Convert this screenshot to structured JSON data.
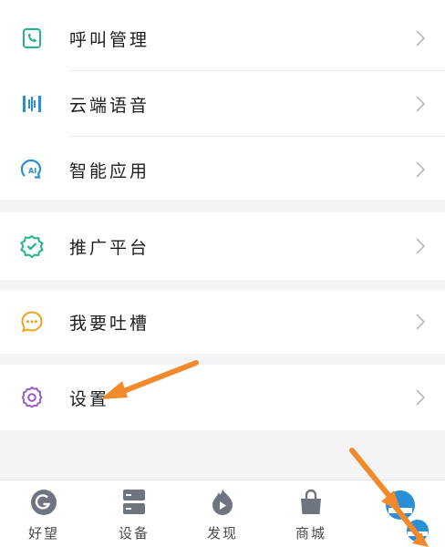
{
  "menu": {
    "items": [
      {
        "label": "呼叫管理",
        "icon": "phone-card-icon"
      },
      {
        "label": "云端语音",
        "icon": "voice-wave-icon"
      },
      {
        "label": "智能应用",
        "icon": "ai-head-icon"
      },
      {
        "label": "推广平台",
        "icon": "verified-badge-icon"
      },
      {
        "label": "我要吐槽",
        "icon": "chat-bubble-icon"
      },
      {
        "label": "设置",
        "icon": "gear-icon"
      }
    ]
  },
  "tabbar": {
    "tabs": [
      {
        "label": "好望",
        "icon": "haowang-logo-icon"
      },
      {
        "label": "设备",
        "icon": "device-icon"
      },
      {
        "label": "发现",
        "icon": "discover-icon"
      },
      {
        "label": "商城",
        "icon": "shop-bag-icon"
      }
    ]
  },
  "colors": {
    "accent_green": "#22b38a",
    "accent_blue": "#2a8fd6",
    "accent_orange": "#f0a21c",
    "accent_purple": "#9b5cc8",
    "annotation_arrow": "#f28a2c"
  }
}
